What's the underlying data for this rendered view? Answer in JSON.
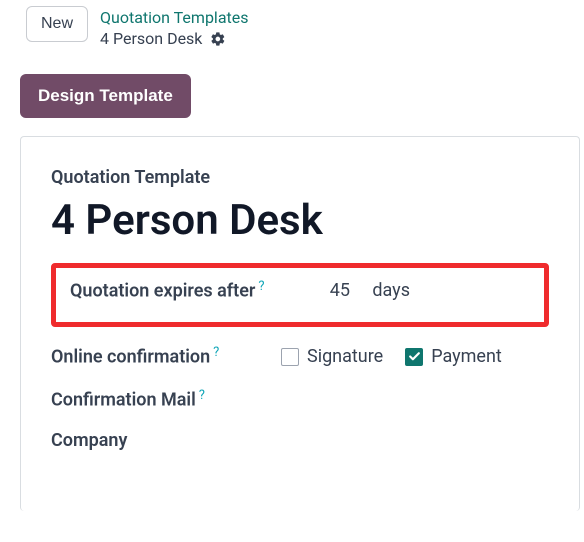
{
  "top": {
    "new_label": "New",
    "breadcrumb_parent": "Quotation Templates",
    "breadcrumb_current": "4 Person Desk"
  },
  "actions": {
    "design_template_label": "Design Template"
  },
  "form": {
    "section_label": "Quotation Template",
    "title": "4 Person Desk",
    "expire": {
      "label": "Quotation expires after",
      "help": "?",
      "value": "45",
      "unit": "days"
    },
    "online_confirmation": {
      "label": "Online confirmation",
      "help": "?",
      "signature_label": "Signature",
      "signature_checked": false,
      "payment_label": "Payment",
      "payment_checked": true
    },
    "confirmation_mail": {
      "label": "Confirmation Mail",
      "help": "?"
    },
    "company": {
      "label": "Company"
    }
  }
}
